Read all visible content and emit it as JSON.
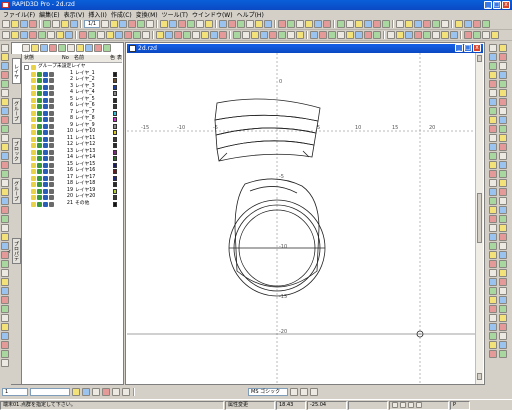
{
  "app": {
    "title": "RAPID3D Pro - 2d.rzd",
    "min_label": "_",
    "max_label": "□",
    "close_label": "x"
  },
  "menu": [
    "ファイル(F)",
    "編集(E)",
    "表示(V)",
    "挿入(I)",
    "作成(C)",
    "変換(M)",
    "ツール(T)",
    "ウインドウ(W)",
    "ヘルプ(H)"
  ],
  "toolbar": {
    "page_counter": "1/1"
  },
  "panel": {
    "tabs": [
      "レイヤ",
      "グループ",
      "ブロック",
      "グループ",
      "プロパティ"
    ],
    "headers": {
      "status": "状態",
      "no": "No",
      "name": "名前",
      "color": "色",
      "line": "表"
    },
    "root_label": "グループ未設定レイヤ",
    "layers": [
      {
        "no": "1",
        "name": "レイヤ_1",
        "color": "#1a1a1a"
      },
      {
        "no": "2",
        "name": "レイヤ_2",
        "color": "#6b4a2a"
      },
      {
        "no": "3",
        "name": "レイヤ_3",
        "color": "#1a3fa8"
      },
      {
        "no": "4",
        "name": "レイヤ_4",
        "color": "#8a8a8a"
      },
      {
        "no": "5",
        "name": "レイヤ_5",
        "color": "#2a2a2a"
      },
      {
        "no": "6",
        "name": "レイヤ_6",
        "color": "#3a3a3a"
      },
      {
        "no": "7",
        "name": "レイヤ_7",
        "color": "#33c0d8"
      },
      {
        "no": "8",
        "name": "レイヤ_8",
        "color": "#cc33cc"
      },
      {
        "no": "9",
        "name": "レイヤ_9",
        "color": "#8a8a8a"
      },
      {
        "no": "10",
        "name": "レイヤ10",
        "color": "#d9c820"
      },
      {
        "no": "11",
        "name": "レイヤ11",
        "color": "#3a3a3a"
      },
      {
        "no": "12",
        "name": "レイヤ12",
        "color": "#2a2a2a"
      },
      {
        "no": "13",
        "name": "レイヤ13",
        "color": "#7a2a7a"
      },
      {
        "no": "14",
        "name": "レイヤ14",
        "color": "#2a6a2a"
      },
      {
        "no": "15",
        "name": "レイヤ15",
        "color": "#1a1a6a"
      },
      {
        "no": "16",
        "name": "レイヤ16",
        "color": "#6a1a1a"
      },
      {
        "no": "17",
        "name": "レイヤ17",
        "color": "#1a2a8a"
      },
      {
        "no": "18",
        "name": "レイヤ18",
        "color": "#2a2a2a"
      },
      {
        "no": "19",
        "name": "レイヤ19",
        "color": "#b0d030"
      },
      {
        "no": "20",
        "name": "レイヤ20",
        "color": "#3a3a3a"
      },
      {
        "no": "21",
        "name": "その他",
        "color": "#111111"
      }
    ]
  },
  "document": {
    "title": "2d.rzd"
  },
  "ruler": {
    "h": [
      "-15",
      "-10",
      "-5",
      "5",
      "10",
      "15",
      "20"
    ],
    "v": [
      "0",
      "-5",
      "-10",
      "-15",
      "-20"
    ]
  },
  "bottom": {
    "line_width": "1",
    "font": "MS ゴシック"
  },
  "status": {
    "message": "端末01.点群を指定して下さい。",
    "mode": "属性変更",
    "x": "18.43",
    "y": "-25.04",
    "zoom": "P"
  }
}
